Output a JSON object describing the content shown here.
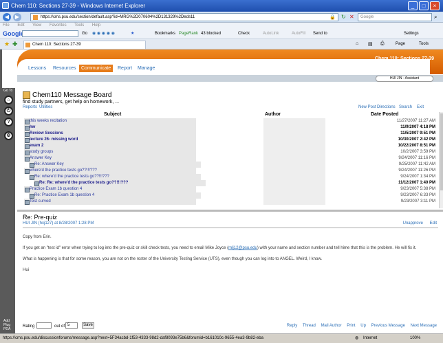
{
  "window": {
    "title": "Chem 110: Sections 27-39 - Windows Internet Explorer"
  },
  "address": {
    "url": "https://cms.psu.edu/section/default.asp?id=MRG%2D070604%2D131329%2Deds11",
    "search_placeholder": "Google"
  },
  "menu": [
    "File",
    "Edit",
    "View",
    "Favorites",
    "Tools",
    "Help"
  ],
  "google_toolbar": {
    "brand": "Google",
    "go": "Go",
    "bookmarks": "Bookmarks",
    "pagerank": "PageRank",
    "blocked": "43 blocked",
    "check": "Check",
    "autolink": "AutoLink",
    "autofill": "AutoFill",
    "sendto": "Send to",
    "settings": "Settings"
  },
  "tab": {
    "label": "Chem 110: Sections 27-39",
    "page_label": "Page",
    "tools_label": "Tools"
  },
  "angel": {
    "course_title": "Chem 110: Sections 27-39",
    "nav": [
      "Lessons",
      "Resources",
      "Communicate",
      "Report",
      "Manage"
    ],
    "user": "HUI JIN - Assistant",
    "side_label": "Go To",
    "side_bottom": [
      "Add Plug",
      "PDA"
    ]
  },
  "board": {
    "title": "Chem110 Message Board",
    "description": "find study partners, get help on homework, ...",
    "links_left": [
      "Reports",
      "Utilities"
    ],
    "links_right": [
      "New Post",
      "Directions",
      "Search",
      "Exit"
    ],
    "headers": {
      "subject": "Subject",
      "author": "Author",
      "date": "Date Posted"
    },
    "rows": [
      {
        "subject": "this weeks recitation",
        "date": "11/27/2007 11:27 AM",
        "bold": false,
        "indent": 0
      },
      {
        "subject": "hw",
        "date": "11/9/2007 4:18 PM",
        "bold": true,
        "indent": 0
      },
      {
        "subject": "Review Sessions",
        "date": "11/5/2007 9:51 PM",
        "bold": true,
        "indent": 0
      },
      {
        "subject": "lecture 26- missing word",
        "date": "10/30/2007 2:42 PM",
        "bold": true,
        "indent": 0
      },
      {
        "subject": "exam 2",
        "date": "10/22/2007 8:51 PM",
        "bold": true,
        "indent": 0
      },
      {
        "subject": "study groups",
        "date": "10/2/2007 3:59 PM",
        "bold": false,
        "indent": 0
      },
      {
        "subject": "Answer Key",
        "date": "9/24/2007 11:16 PM",
        "bold": false,
        "indent": 0
      },
      {
        "subject": "Re: Answer Key",
        "date": "9/25/2007 11:42 AM",
        "bold": false,
        "indent": 1
      },
      {
        "subject": "where'd the practice tests go??!!!???",
        "date": "9/24/2007 11:26 PM",
        "bold": false,
        "indent": 0
      },
      {
        "subject": "Re: where'd the practice tests go??!!!???",
        "date": "9/24/2007 1:34 PM",
        "bold": false,
        "indent": 1
      },
      {
        "subject": "Re: Re: where'd the practice tests go??!!!???",
        "date": "11/12/2007 1:40 PM",
        "bold": true,
        "indent": 2
      },
      {
        "subject": "Practice Exam 1b question 4",
        "date": "9/23/2007 5:38 PM",
        "bold": false,
        "indent": 0
      },
      {
        "subject": "Re: Practice Exam 1b question 4",
        "date": "9/23/2007 6:33 PM",
        "bold": false,
        "indent": 1
      },
      {
        "subject": "Test curved",
        "date": "9/23/2007 3:11 PM",
        "bold": false,
        "indent": 0
      }
    ]
  },
  "message": {
    "title": "Re: Pre-quiz",
    "byline": "HUI JIN (hxj127) at 8/28/2007 1:28 PM",
    "actions": [
      "Unapprove",
      "Edit"
    ],
    "p1": "Copy from Erin.",
    "p2a": "If you get an \"test id\" error when trying to log into the pre-quiz or skill check tests, you need to email Mike Joyce (",
    "p2_email": "mlj12@psu.edu",
    "p2b": ") with your name and section number and tell hime that this is the problem. He will fix it.",
    "p3": "What is happening is that for some reason, you are not on the roster of the University Testing Service (UTS), even though you can log into to ANGEL. Weird, I know.",
    "p4": "Hui"
  },
  "footer": {
    "rating_label": "Rating",
    "out_of_label": "out of",
    "out_of_value": "5",
    "save_label": "Save",
    "actions": [
      "Reply",
      "Thread",
      "Mail Author",
      "Print",
      "Up",
      "Previous Message",
      "Next Message"
    ]
  },
  "status": {
    "url": "https://cms.psu.edu/discussionforums/message.asp?next=5F34acbd-1f53-4333-98d2-daf8093e75b6&forumid=b161010c-9655-4ea3-9b82-eba",
    "zone": "Internet",
    "zoom": "100%"
  }
}
